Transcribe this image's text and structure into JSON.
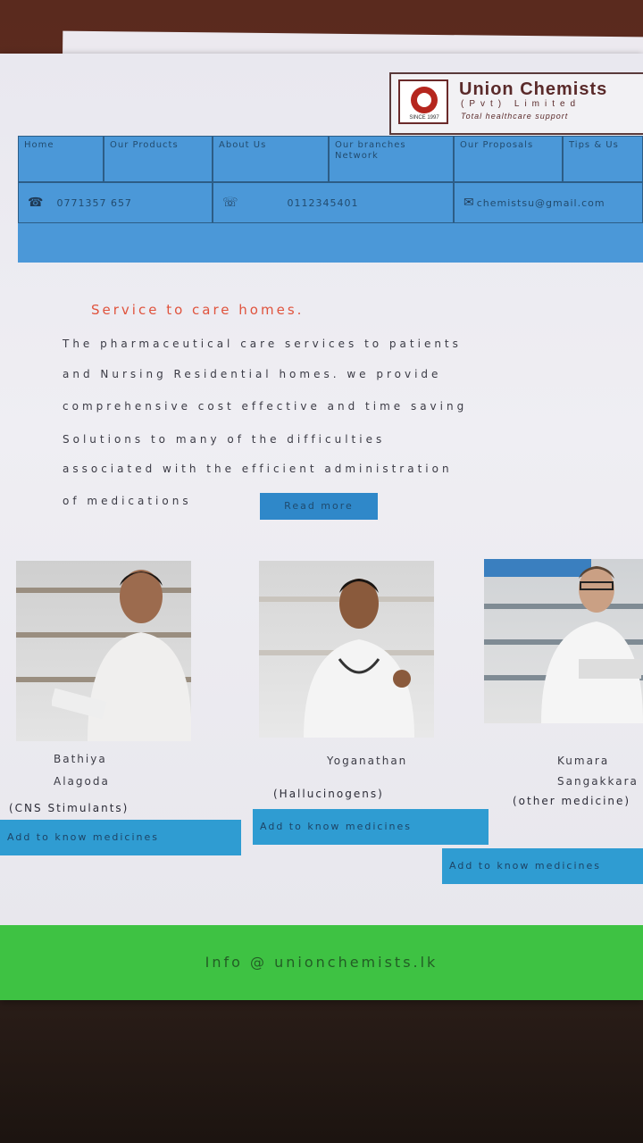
{
  "logo": {
    "name": "Union Chemists",
    "sub": "(Pvt) Limited",
    "tagline": "Total healthcare support",
    "since": "SINCE 1997"
  },
  "nav": {
    "items": [
      "Home",
      "Our Products",
      "About Us",
      "Our branches Network",
      "Our Proposals",
      "Tips & Us"
    ],
    "phone": "0771357 657",
    "fax": "0112345401",
    "email": "chemistsu@gmail.com"
  },
  "service": {
    "title": "Service to care homes.",
    "lines": [
      "The  pharmaceutical    care    services   to   patients",
      "and  Nursing  Residential  homes.   we    provide",
      "comprehensive   cost   effective    and   time  saving",
      "Solutions   to   many   of    the   difficulties",
      "associated      with     the     efficient    administration",
      "of  medications"
    ],
    "read_more": "Read more"
  },
  "pharmacists": [
    {
      "name_line1": "Bathiya",
      "name_line2": "Alagoda",
      "category": "(CNS Stimulants)",
      "button": "Add to know medicines"
    },
    {
      "name_line1": "Yoganathan",
      "name_line2": "",
      "category": "(Hallucinogens)",
      "button": "Add to know medicines"
    },
    {
      "name_line1": "Kumara",
      "name_line2": "Sangakkara",
      "category": "(other medicine)",
      "button": "Add to know medicines"
    }
  ],
  "footer": {
    "email": "Info @ unionchemists.lk"
  },
  "colors": {
    "nav_blue": "#4b98d8",
    "accent_red": "#e0533d",
    "footer_green": "#3ec243",
    "button_blue": "#2f9cd2"
  }
}
